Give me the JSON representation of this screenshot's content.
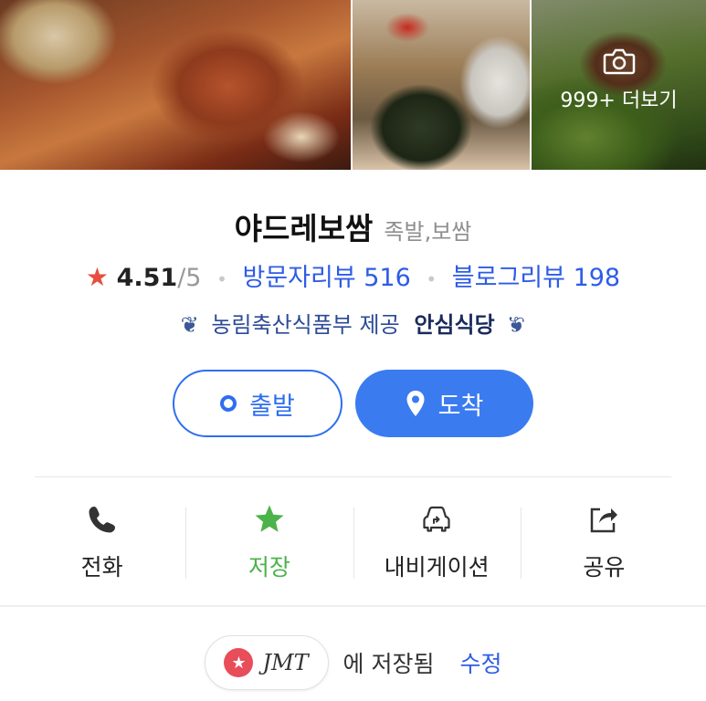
{
  "photos": {
    "more_label": "999+ 더보기"
  },
  "place": {
    "name": "야드레보쌈",
    "category": "족발,보쌈"
  },
  "rating": {
    "score": "4.51",
    "max": "/5",
    "visitor_reviews": "방문자리뷰 516",
    "blog_reviews": "블로그리뷰 198"
  },
  "certification": {
    "text": "농림축산식품부 제공",
    "badge": "안심식당"
  },
  "directions": {
    "depart_label": "출발",
    "arrive_label": "도착"
  },
  "actions": [
    {
      "label": "전화",
      "icon": "phone-icon"
    },
    {
      "label": "저장",
      "icon": "star-icon",
      "active_color": "#4cb34a"
    },
    {
      "label": "내비게이션",
      "icon": "car-navigation-icon"
    },
    {
      "label": "공유",
      "icon": "share-icon"
    }
  ],
  "saved": {
    "list_name": "JMT",
    "saved_text": "에 저장됨",
    "edit_label": "수정"
  },
  "colors": {
    "accent_blue": "#3a7bf0",
    "star_red": "#e84d3d",
    "saved_green": "#4cb34a"
  }
}
